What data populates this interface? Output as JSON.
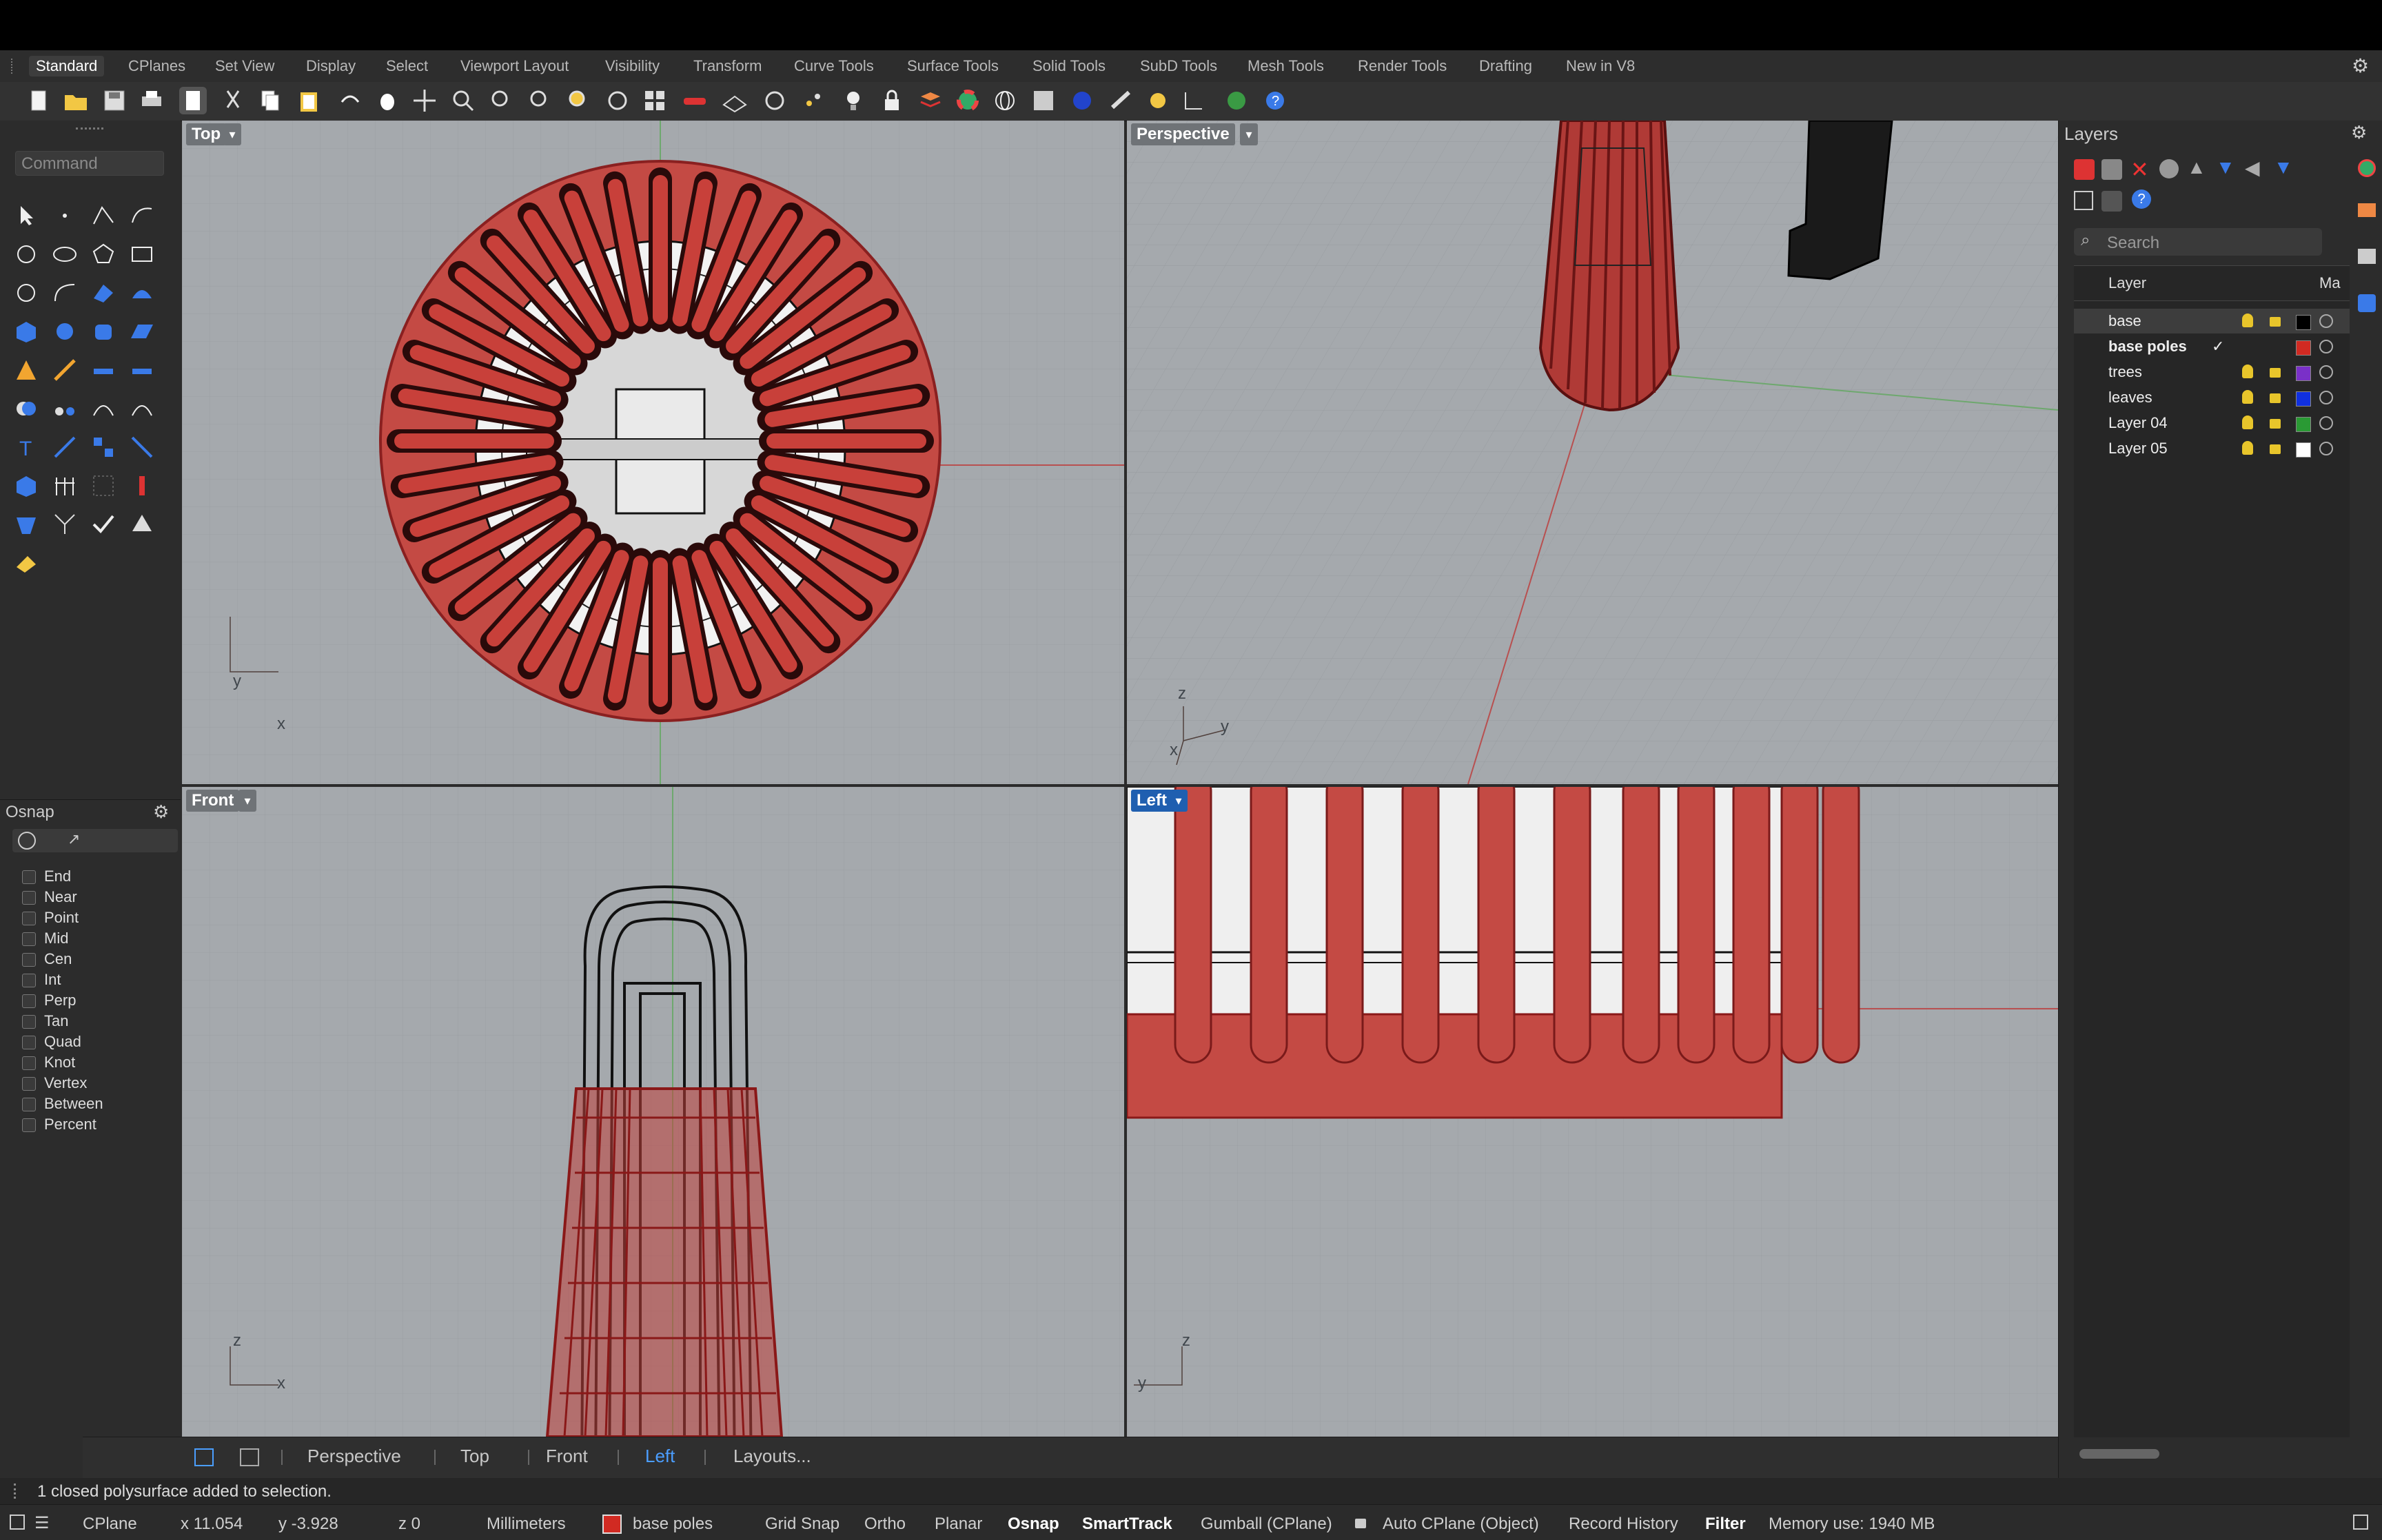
{
  "menu_tabs": [
    "Standard",
    "CPlanes",
    "Set View",
    "Display",
    "Select",
    "Viewport Layout",
    "Visibility",
    "Transform",
    "Curve Tools",
    "Surface Tools",
    "Solid Tools",
    "SubD Tools",
    "Mesh Tools",
    "Render Tools",
    "Drafting",
    "New in V8"
  ],
  "active_tab": "Standard",
  "command": {
    "placeholder": "Command"
  },
  "osnap": {
    "title": "Osnap",
    "items": [
      "End",
      "Near",
      "Point",
      "Mid",
      "Cen",
      "Int",
      "Perp",
      "Tan",
      "Quad",
      "Knot",
      "Vertex",
      "Between",
      "Percent"
    ]
  },
  "viewports": {
    "top": {
      "label": "Top"
    },
    "perspective": {
      "label": "Perspective"
    },
    "front": {
      "label": "Front"
    },
    "left": {
      "label": "Left"
    }
  },
  "axis_labels": {
    "x": "x",
    "y": "y",
    "z": "z"
  },
  "layers": {
    "title": "Layers",
    "search_placeholder": "Search",
    "col_layer": "Layer",
    "col_material": "Ma",
    "rows": [
      {
        "name": "base",
        "color": "#000000",
        "selected": true,
        "current": false
      },
      {
        "name": "base poles",
        "color": "#d12a22",
        "selected": false,
        "current": true
      },
      {
        "name": "trees",
        "color": "#7a30c8",
        "selected": false,
        "current": false
      },
      {
        "name": "leaves",
        "color": "#1030e0",
        "selected": false,
        "current": false
      },
      {
        "name": "Layer 04",
        "color": "#2a9a34",
        "selected": false,
        "current": false
      },
      {
        "name": "Layer 05",
        "color": "#ffffff",
        "selected": false,
        "current": false
      }
    ]
  },
  "viewport_tabs": [
    "Perspective",
    "Top",
    "Front",
    "Left",
    "Layouts..."
  ],
  "active_viewport_tab": "Left",
  "command_history": "1 closed polysurface added to selection.",
  "status": {
    "cplane": "CPlane",
    "x": "x 11.054",
    "y": "y -3.928",
    "z": "z 0",
    "units": "Millimeters",
    "current_layer": "base poles",
    "current_layer_color": "#d12a22",
    "grid_snap": "Grid Snap",
    "ortho": "Ortho",
    "planar": "Planar",
    "osnap": "Osnap",
    "smarttrack": "SmartTrack",
    "gumball": "Gumball (CPlane)",
    "auto_cplane": "Auto CPlane (Object)",
    "record_history": "Record History",
    "filter": "Filter",
    "memory": "Memory use: 1940 MB"
  },
  "colors": {
    "accent": "#4b9eff",
    "object_red": "#c8403a",
    "viewport_bg": "#a5a9ad"
  }
}
